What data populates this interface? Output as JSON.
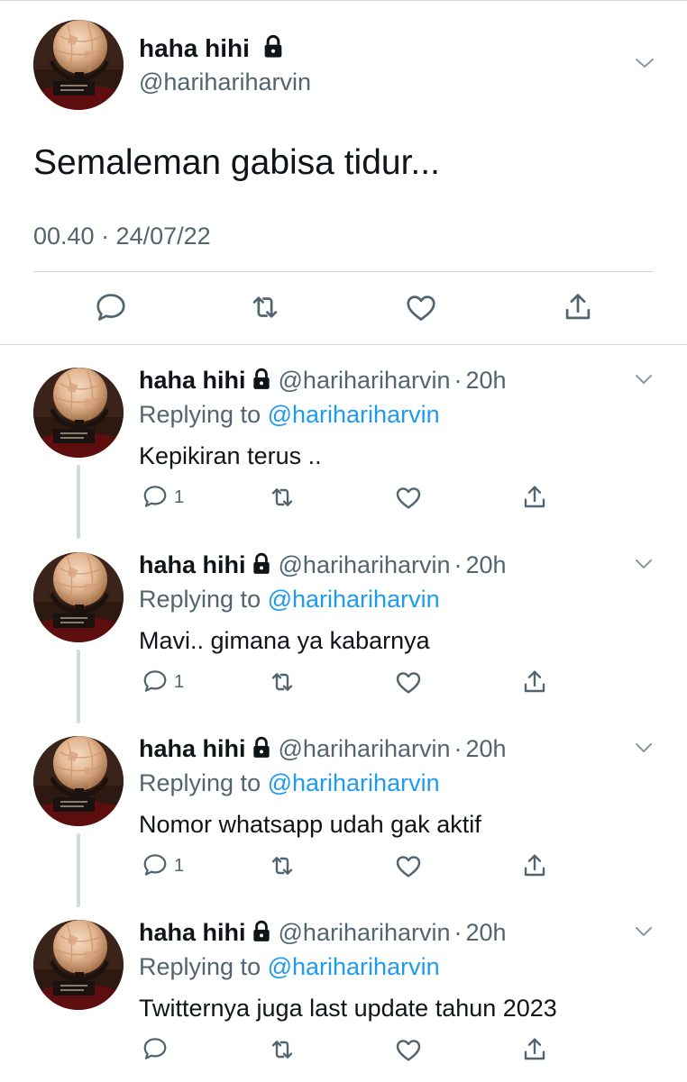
{
  "main_tweet": {
    "display_name": "haha hihi",
    "handle": "@harihariharvin",
    "text": "Semaleman gabisa tidur...",
    "timestamp": "00.40 · 24/07/22",
    "icons": [
      "avatar-globe",
      "lock-icon",
      "chevron-down-icon",
      "reply-icon",
      "retweet-icon",
      "like-icon",
      "share-icon"
    ]
  },
  "replies": [
    {
      "display_name": "haha hihi",
      "handle": "@harihariharvin",
      "dot": "·",
      "time": "20h",
      "replying_prefix": "Replying to ",
      "replying_to": "@harihariharvin",
      "text": "Kepikiran terus ..",
      "reply_count": "1"
    },
    {
      "display_name": "haha hihi",
      "handle": "@harihariharvin",
      "dot": "·",
      "time": "20h",
      "replying_prefix": "Replying to ",
      "replying_to": "@harihariharvin",
      "text": "Mavi.. gimana ya kabarnya",
      "reply_count": "1"
    },
    {
      "display_name": "haha hihi",
      "handle": "@harihariharvin",
      "dot": "·",
      "time": "20h",
      "replying_prefix": "Replying to ",
      "replying_to": "@harihariharvin",
      "text": "Nomor whatsapp udah gak aktif",
      "reply_count": "1"
    },
    {
      "display_name": "haha hihi",
      "handle": "@harihariharvin",
      "dot": "·",
      "time": "20h",
      "replying_prefix": "Replying to ",
      "replying_to": "@harihariharvin",
      "text": "Twitternya juga last update tahun 2023",
      "reply_count": ""
    }
  ],
  "colors": {
    "text": "#0f1419",
    "secondary": "#536471",
    "mention": "#1d9bf0",
    "divider": "#cfd9de"
  }
}
